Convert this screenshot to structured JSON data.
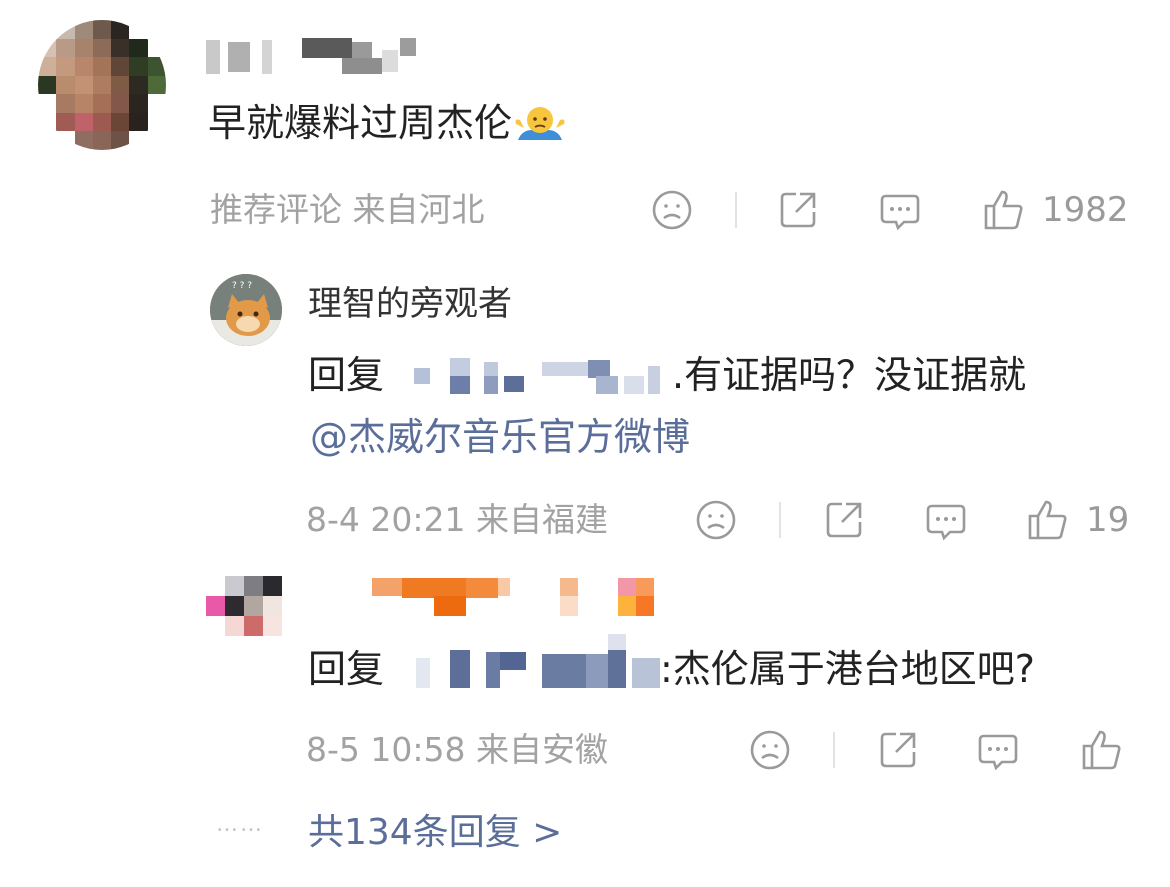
{
  "comment": {
    "text": "早就爆料过周杰伦",
    "emoji": "shrug-emoji",
    "meta": "推荐评论 来自河北",
    "like_count": "1982"
  },
  "reply1": {
    "username": "理智的旁观者",
    "reply_prefix": "回复",
    "text": ".有证据吗？没证据就",
    "mention": "@杰威尔音乐官方微博",
    "meta": "8-4 20:21 来自福建",
    "like_count": "19"
  },
  "reply2": {
    "reply_prefix": "回复",
    "text": ":杰伦属于港台地区吧?",
    "meta": "8-5 10:58 来自安徽",
    "like_count": ""
  },
  "more_replies": {
    "dots": "……",
    "label": "共134条回复 >"
  },
  "colors": {
    "link": "#5b6e9a",
    "meta": "#a2a2a2",
    "icon": "#9a9a9a"
  }
}
